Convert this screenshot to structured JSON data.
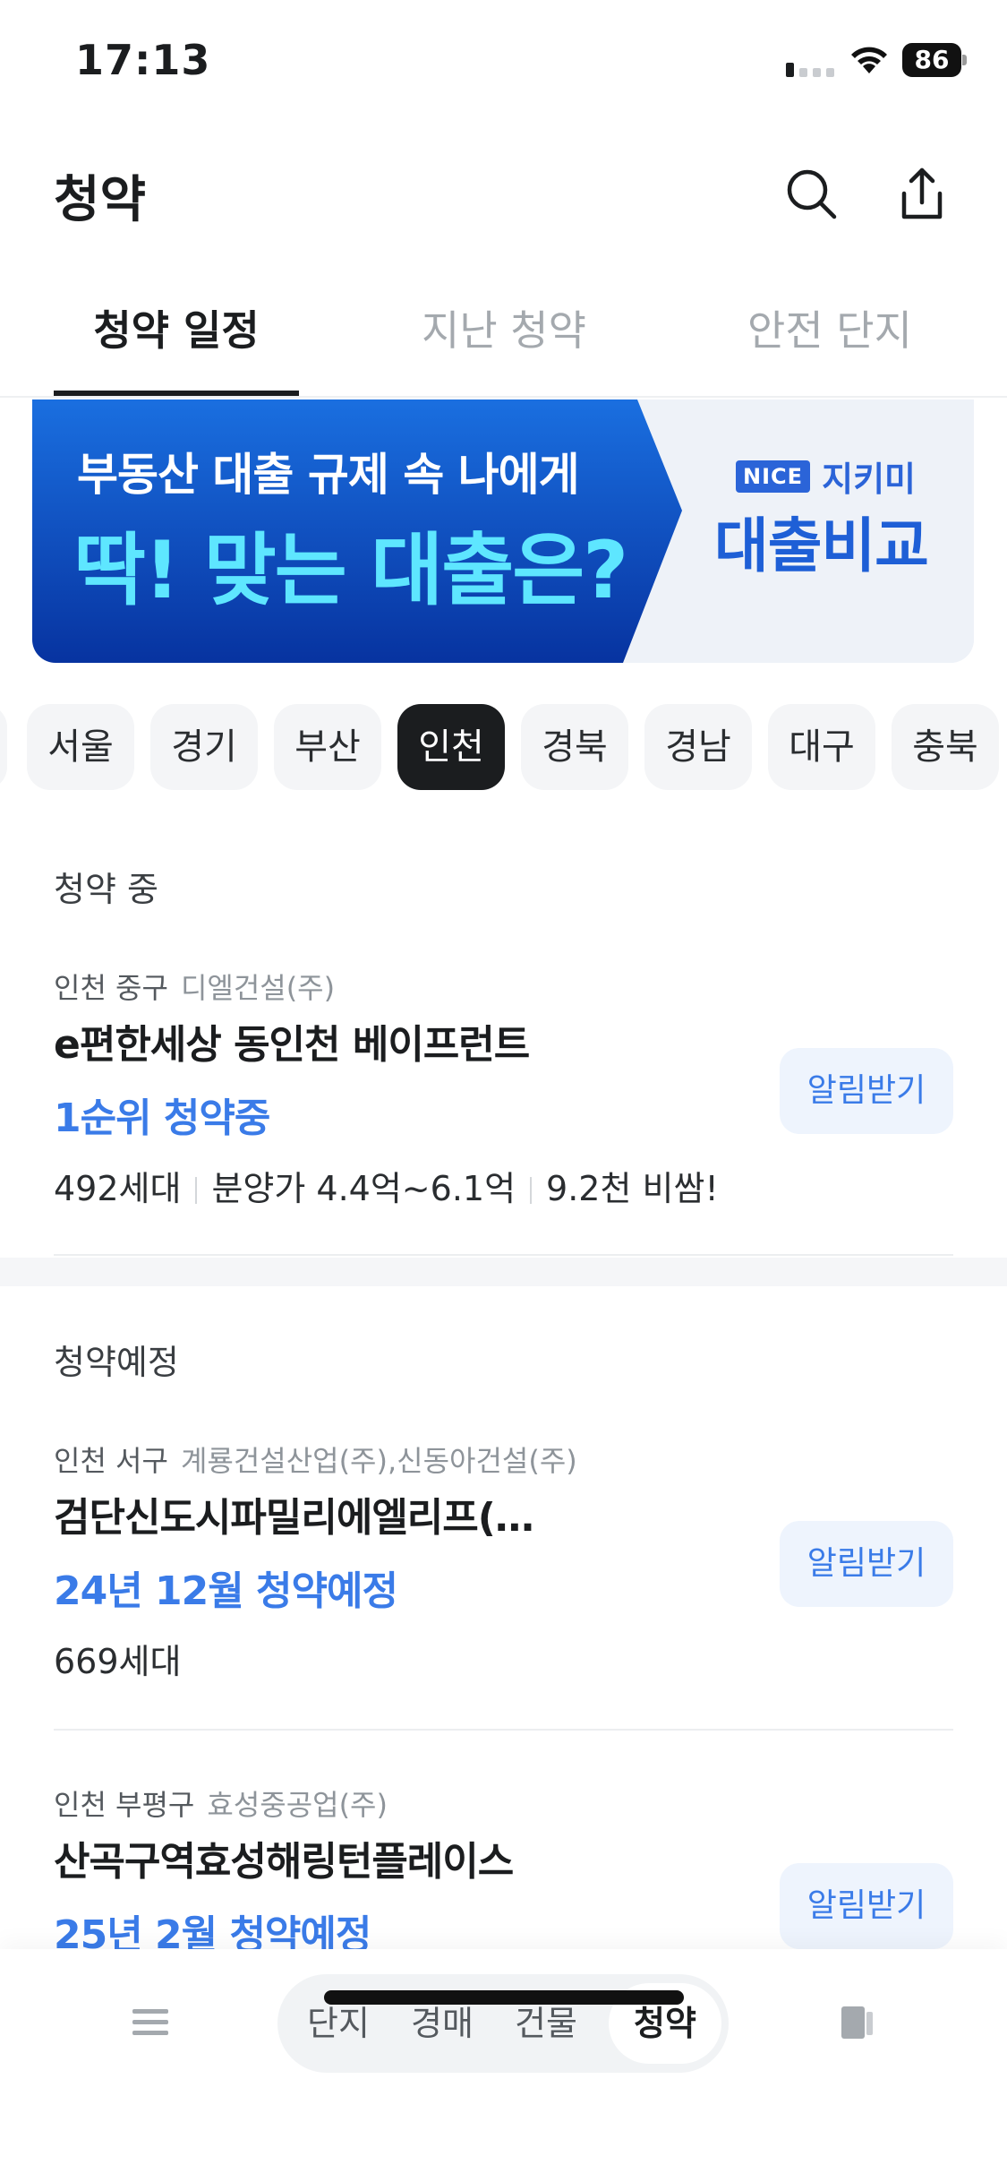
{
  "status_bar": {
    "time": "17:13",
    "battery": "86"
  },
  "header": {
    "title": "청약"
  },
  "tabs": [
    {
      "label": "청약 일정",
      "active": true
    },
    {
      "label": "지난 청약",
      "active": false
    },
    {
      "label": "안전 단지",
      "active": false
    }
  ],
  "banner": {
    "line1": "부동산 대출 규제 속 나에게",
    "line2": "딱! 맞는 대출은?",
    "brand_badge": "NICE",
    "brand_name": "지키미",
    "cta": "대출비교",
    "colors": {
      "primary": "#0a3fb0",
      "accent": "#5ee6ff"
    }
  },
  "regions": [
    "서울",
    "경기",
    "부산",
    "인천",
    "경북",
    "경남",
    "대구",
    "충북"
  ],
  "active_region": "인천",
  "sections": {
    "ongoing": {
      "title": "청약 중",
      "items": [
        {
          "region": "인천 중구",
          "builder": "디엘건설(주)",
          "name": "e편한세상 동인천 베이프런트",
          "status": "1순위 청약중",
          "households": "492세대",
          "price": "분양가 4.4억~6.1억",
          "compare": "9.2천 비쌈!",
          "alert_label": "알림받기"
        }
      ]
    },
    "upcoming": {
      "title": "청약예정",
      "items": [
        {
          "region": "인천 서구",
          "builder": "계룡건설산업(주),신동아건설(주)",
          "name": "검단신도시파밀리에엘리프(…",
          "status": "24년 12월 청약예정",
          "households": "669세대",
          "alert_label": "알림받기"
        },
        {
          "region": "인천 부평구",
          "builder": "효성중공업(주)",
          "name": "산곡구역효성해링턴플레이스",
          "status": "25년 2월 청약예정",
          "alert_label": "알림받기"
        }
      ]
    }
  },
  "bottom_nav": {
    "tabs": [
      {
        "label": "단지",
        "active": false
      },
      {
        "label": "경매",
        "active": false
      },
      {
        "label": "건물",
        "active": false
      },
      {
        "label": "청약",
        "active": true
      }
    ]
  },
  "colors": {
    "accent": "#3a7be8",
    "dark": "#1b1d1f"
  }
}
